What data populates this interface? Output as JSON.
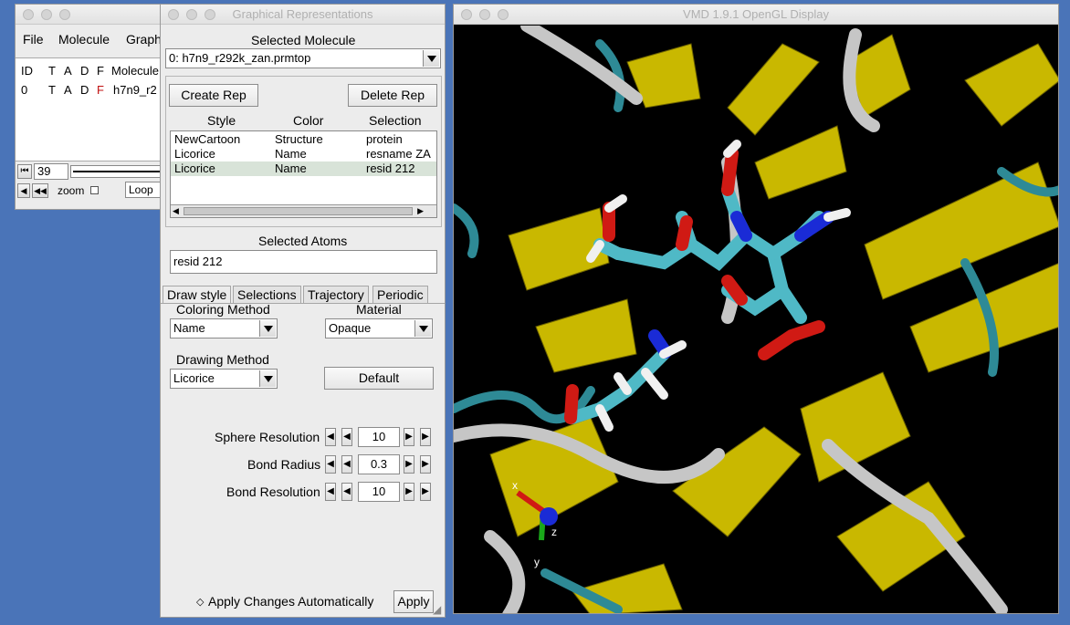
{
  "main_window": {
    "menu": [
      "File",
      "Molecule",
      "Graph"
    ],
    "headers": [
      "ID",
      "T",
      "A",
      "D",
      "F",
      "Molecule"
    ],
    "row": {
      "id": "0",
      "t": "T",
      "a": "A",
      "d": "D",
      "f": "F",
      "molecule": "h7n9_r2"
    },
    "frame_value": "39",
    "zoom_label": "zoom",
    "loop_label": "Loop"
  },
  "graph_rep": {
    "title": "Graphical Representations",
    "selected_molecule_label": "Selected Molecule",
    "selected_molecule_value": "0: h7n9_r292k_zan.prmtop",
    "create_rep": "Create Rep",
    "delete_rep": "Delete Rep",
    "columns": [
      "Style",
      "Color",
      "Selection"
    ],
    "reps": [
      {
        "style": "NewCartoon",
        "color": "Structure",
        "selection": "protein"
      },
      {
        "style": "Licorice",
        "color": "Name",
        "selection": "resname ZA"
      },
      {
        "style": "Licorice",
        "color": "Name",
        "selection": "resid 212"
      }
    ],
    "selected_atoms_label": "Selected Atoms",
    "selected_atoms_value": "resid 212",
    "tabs": [
      "Draw style",
      "Selections",
      "Trajectory",
      "Periodic"
    ],
    "coloring_method_label": "Coloring Method",
    "coloring_method_value": "Name",
    "material_label": "Material",
    "material_value": "Opaque",
    "drawing_method_label": "Drawing Method",
    "drawing_method_value": "Licorice",
    "default_button": "Default",
    "params": [
      {
        "label": "Sphere Resolution",
        "value": "10"
      },
      {
        "label": "Bond Radius",
        "value": "0.3"
      },
      {
        "label": "Bond Resolution",
        "value": "10"
      }
    ],
    "apply_auto_label": "Apply Changes Automatically",
    "apply_button": "Apply"
  },
  "display": {
    "title": "VMD 1.9.1 OpenGL Display",
    "axes": {
      "x": "x",
      "y": "y",
      "z": "z"
    }
  },
  "colors": {
    "desktop": "#4a74b8",
    "sheet": "#c9b800",
    "coil_teal": "#2e8a96",
    "tube": "#c6c6c6",
    "carbon": "#4fb9c6",
    "oxygen": "#d01a14",
    "nitrogen": "#1a2bd6",
    "hydrogen": "#f0f0f0",
    "selected_row": "#d8e3d8"
  }
}
